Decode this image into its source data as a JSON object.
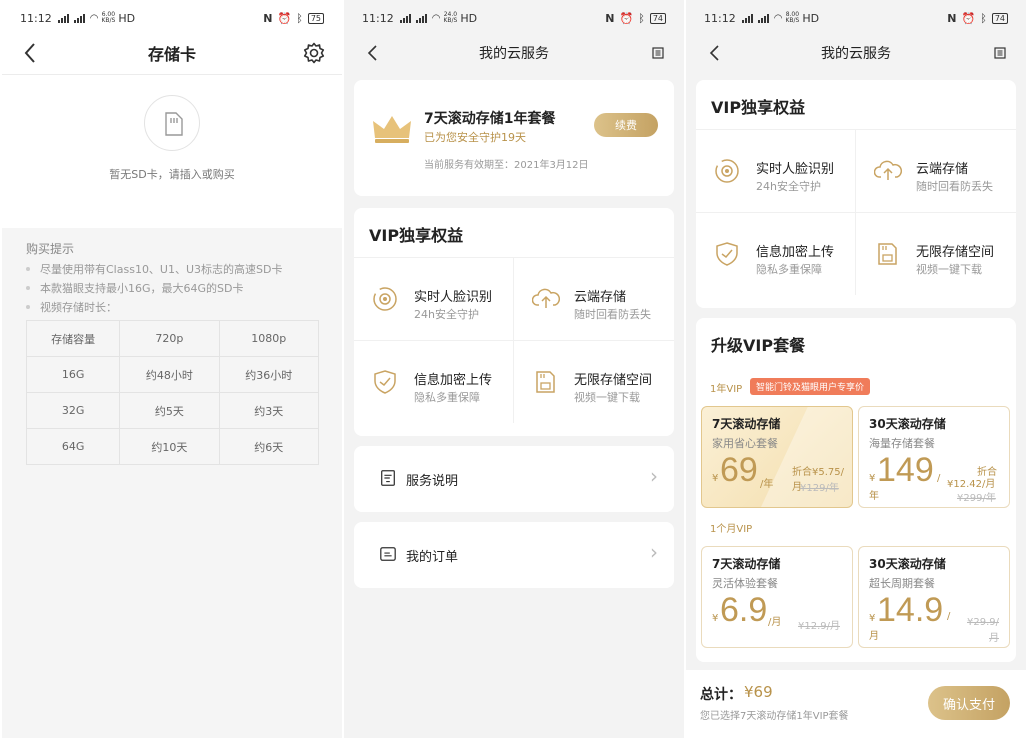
{
  "status": [
    {
      "time": "11:12",
      "net": "6.00\nKB/S",
      "hd": "HD",
      "battery": "75"
    },
    {
      "time": "11:12",
      "net": "24.0\nKB/S",
      "hd": "HD",
      "battery": "74"
    },
    {
      "time": "11:12",
      "net": "8.00\nKB/S",
      "hd": "HD",
      "battery": "74"
    }
  ],
  "sd": {
    "title": "存储卡",
    "empty_text": "暂无SD卡，请插入或购买",
    "tips_title": "购买提示",
    "tips": [
      "尽量使用带有Class10、U1、U3标志的高速SD卡",
      "本款猫眼支持最小16G，最大64G的SD卡",
      "视频存储时长："
    ],
    "table": {
      "headers": [
        "存储容量",
        "720p",
        "1080p"
      ],
      "rows": [
        [
          "16G",
          "约48小时",
          "约36小时"
        ],
        [
          "32G",
          "约5天",
          "约3天"
        ],
        [
          "64G",
          "约10天",
          "约6天"
        ]
      ]
    }
  },
  "cloud": {
    "title": "我的云服务",
    "plan": {
      "name": "7天滚动存储1年套餐",
      "guard": "已为您安全守护19天",
      "renew": "续费",
      "expiry": "当前服务有效期至：2021年3月12日"
    },
    "vip_title": "VIP独享权益",
    "benefits": [
      {
        "title": "实时人脸识别",
        "sub": "24h安全守护"
      },
      {
        "title": "云端存储",
        "sub": "随时回看防丢失"
      },
      {
        "title": "信息加密上传",
        "sub": "隐私多重保障"
      },
      {
        "title": "无限存储空间",
        "sub": "视频一键下载"
      }
    ],
    "links": [
      {
        "label": "服务说明",
        "chevron": "›"
      },
      {
        "label": "我的订单",
        "chevron": "›"
      }
    ]
  },
  "upgrade": {
    "title": "我的云服务",
    "vip_title": "VIP独享权益",
    "upgrade_title": "升级VIP套餐",
    "year_label": "1年VIP",
    "promo": "智能门铃及猫眼用户专享价",
    "month_label": "1个月VIP",
    "yen": "¥",
    "packages": [
      {
        "name": "7天滚动存储",
        "desc": "家用省心套餐",
        "price": "69",
        "unit": "/年",
        "avg": "折合¥5.75/月",
        "old": "¥129/年",
        "selected": true
      },
      {
        "name": "30天滚动存储",
        "desc": "海量存储套餐",
        "price": "149",
        "unit": "/",
        "unit2": "年",
        "avg": "折合",
        "avg2": "¥12.42/月",
        "old": "¥299/年",
        "selected": false
      },
      {
        "name": "7天滚动存储",
        "desc": "灵活体验套餐",
        "price": "6.9",
        "unit": "/月",
        "old": "¥12.9/月",
        "selected": false
      },
      {
        "name": "30天滚动存储",
        "desc": "超长周期套餐",
        "price": "14.9",
        "unit": "/",
        "unit2": "月",
        "old": "¥29.9/",
        "old2": "月",
        "selected": false
      }
    ],
    "total_label": "总计：",
    "total_value": "¥69",
    "selected_text": "您已选择7天滚动存储1年VIP套餐",
    "pay": "确认支付"
  },
  "colors": {
    "gold": "#b8924a",
    "bg": "#f3f3f3",
    "promo": "#f07c5a"
  }
}
